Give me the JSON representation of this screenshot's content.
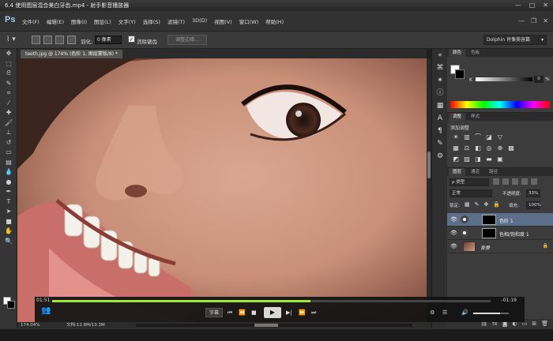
{
  "window": {
    "title": "6.4 使用图层混合美白牙齿.mp4 - 射手影音播放器",
    "minimize": "—",
    "maximize": "□",
    "close": "✕"
  },
  "ps": {
    "logo": "Ps",
    "menu": [
      "文件(F)",
      "编辑(E)",
      "图像(I)",
      "图层(L)",
      "文字(Y)",
      "选择(S)",
      "滤镜(T)",
      "3D(D)",
      "视图(V)",
      "窗口(W)",
      "帮助(H)"
    ],
    "options": {
      "feather_label": "羽化:",
      "feather_value": "0 像素",
      "antialias_label": "消除锯齿",
      "refine_edge": "调整边缘...",
      "workspace": "Dolphin 肖像美容篇"
    },
    "document_tab": "teeth.jpg @ 174% (色阶 1, 图层蒙版/8) *",
    "status": {
      "zoom": "174.04%",
      "doc": "文档:12.8M/13.3M"
    }
  },
  "panels": {
    "color": {
      "tabs": [
        "颜色",
        "色板"
      ],
      "k_label": "K",
      "k_value": "0",
      "percent": "%"
    },
    "adjustments": {
      "tabs": [
        "调整",
        "样式"
      ],
      "title": "添加调整"
    },
    "layers": {
      "tabs": [
        "图层",
        "通道",
        "路径"
      ],
      "filter": "ρ 类型",
      "blend_mode": "正常",
      "opacity_label": "不透明度:",
      "opacity": "33%",
      "lock_label": "锁定:",
      "fill_label": "填充:",
      "fill": "100%",
      "items": [
        {
          "name": "色阶 1",
          "selected": true
        },
        {
          "name": "色相/饱和度 1",
          "selected": false
        },
        {
          "name": "背景",
          "selected": false,
          "locked": true
        }
      ]
    }
  },
  "player": {
    "time_current": "01:51",
    "time_remaining": "-01:19",
    "progress": 0.59,
    "subtitle_button": "字幕",
    "volume": 0.75
  }
}
